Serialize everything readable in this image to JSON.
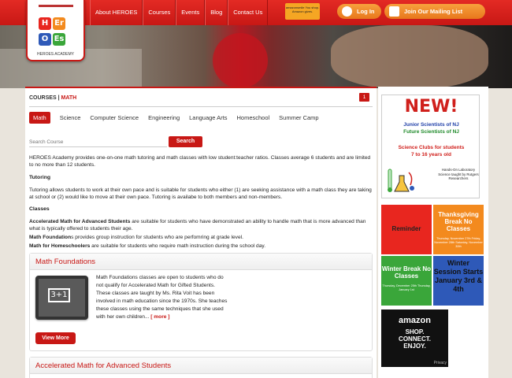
{
  "header": {
    "logo_caption": "HEROES ACADEMY",
    "logo_letters": [
      "H",
      "Er",
      "O",
      "Es"
    ],
    "nav": [
      "About HEROES",
      "Courses",
      "Events",
      "Blog",
      "Contact Us"
    ],
    "amazon_smile_text": "amazonsmile You shop. Amazon gives.",
    "login_label": "Log In",
    "mailing_label": "Join Our Mailing List"
  },
  "main": {
    "breadcrumb_section": "COURSES",
    "breadcrumb_sep": "|",
    "breadcrumb_page": "MATH",
    "badge": "1",
    "tabs": [
      "Math",
      "Science",
      "Computer Science",
      "Engineering",
      "Language Arts",
      "Homeschool",
      "Summer Camp"
    ],
    "active_tab": "Math",
    "search_placeholder": "Search Course",
    "search_button": "Search",
    "intro": "HEROES Academy provides one-on-one math tutoring and math classes with low student:teacher ratios.  Classes average 6 students and are limited to no more than 12 students.",
    "tutoring_heading": "Tutoring",
    "tutoring_text": "Tutoring allows students to work at their own pace and is suitable for students who either (1) are seeking assistance with a math class they are taking at school or (2) would like to move at their own pace.  Tutoring is availabe to both members and non-members.",
    "classes_heading": "Classes",
    "class_lines": [
      {
        "bold": "Accelerated Math for Advanced Students",
        "rest": " are suitable for students who have demonstrated an ability to handle math that is more advanced than what is typically offered to students their age."
      },
      {
        "bold": "Math Foundation",
        "rest": "s provides group instruction for students who are perfomring at grade level."
      },
      {
        "bold": "Math for Homeschoolers",
        "rest": " are suitable for students who require math instruction during the school day."
      }
    ],
    "courses": [
      {
        "title": "Math Foundations",
        "image_text": "3+1",
        "description": "Math Foundations classes are open to students who do not qualify for Accelerated Math for Gifted Students.  These classes are taught by Ms. Rita Voit has been involved in math education since the 1970s.  She teaches these classes using the same techniques that she used with her own children...",
        "more_label": "[ more ]",
        "button": "View More"
      },
      {
        "title": "Accelerated Math for Advanced Students"
      }
    ]
  },
  "sidebar": {
    "new_ad": {
      "headline": "NEW!",
      "line1": "Junior Scientists of NJ",
      "line2": "Future Scientists of NJ",
      "line3": "Science Clubs for students",
      "line4": "7 to 16 years old",
      "line5": "Hands-On Laboratory Science taught by Rutgers Researchers"
    },
    "notices": [
      {
        "big": "Reminder",
        "small": "",
        "color": "#e8261f"
      },
      {
        "big": "Thanksgiving Break No Classes",
        "small": "Thursday, November 27th  Friday, November 28th  Saturday, November 30th",
        "color": "#f38a1e"
      },
      {
        "big": "Winter Break No Classes",
        "small": "Thursday, December 25th  Thursday, January 1st",
        "color": "#3aa63a"
      },
      {
        "big": "Winter Session Starts January 3rd & 4th",
        "small": "",
        "color": "#2e59b8"
      }
    ],
    "amazon_ad": {
      "brand": "amazon",
      "line1": "SHOP.",
      "line2": "CONNECT.",
      "line3": "ENJOY.",
      "privacy": "Privacy"
    }
  }
}
